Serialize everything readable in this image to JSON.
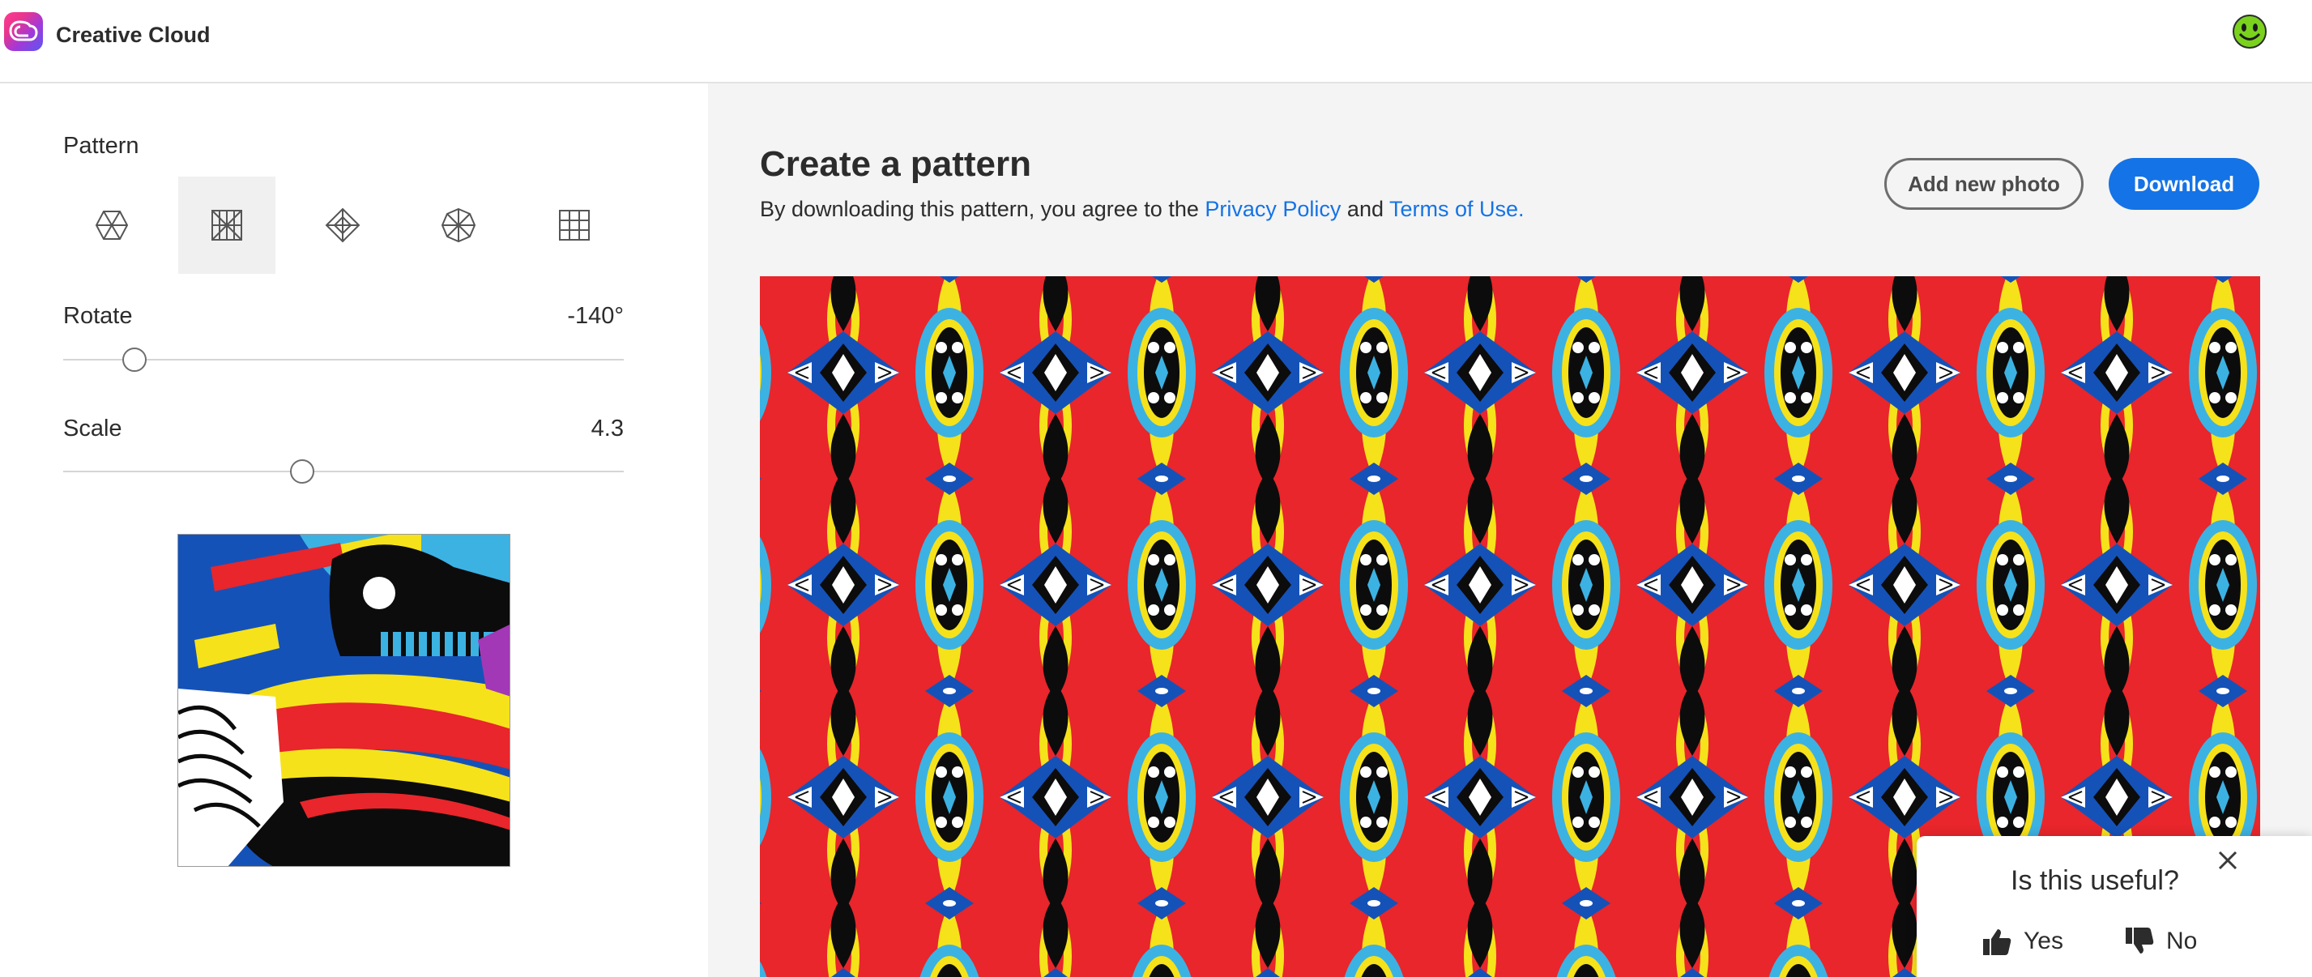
{
  "app": {
    "title": "Creative Cloud"
  },
  "left": {
    "pattern_label": "Pattern",
    "pattern_types": [
      {
        "icon": "hexagon-pattern-icon",
        "selected": false
      },
      {
        "icon": "square-mirror-pattern-icon",
        "selected": true
      },
      {
        "icon": "diamond-pattern-icon",
        "selected": false
      },
      {
        "icon": "radial-pattern-icon",
        "selected": false
      },
      {
        "icon": "grid-pattern-icon",
        "selected": false
      }
    ],
    "rotate": {
      "label": "Rotate",
      "value": "-140°"
    },
    "scale": {
      "label": "Scale",
      "value": "4.3"
    }
  },
  "main": {
    "title": "Create a pattern",
    "agree_prefix": "By downloading this pattern, you agree to the ",
    "privacy_link": "Privacy Policy",
    "agree_and": " and ",
    "terms_link": "Terms of Use.",
    "add_photo_label": "Add new photo",
    "download_label": "Download"
  },
  "feedback": {
    "question": "Is this useful?",
    "yes_label": "Yes",
    "no_label": "No"
  },
  "colors": {
    "accent": "#1473e6",
    "pattern_red": "#e8262b",
    "pattern_yellow": "#f6e21a",
    "pattern_blue": "#1552b8",
    "pattern_lightblue": "#3cb2e3"
  }
}
